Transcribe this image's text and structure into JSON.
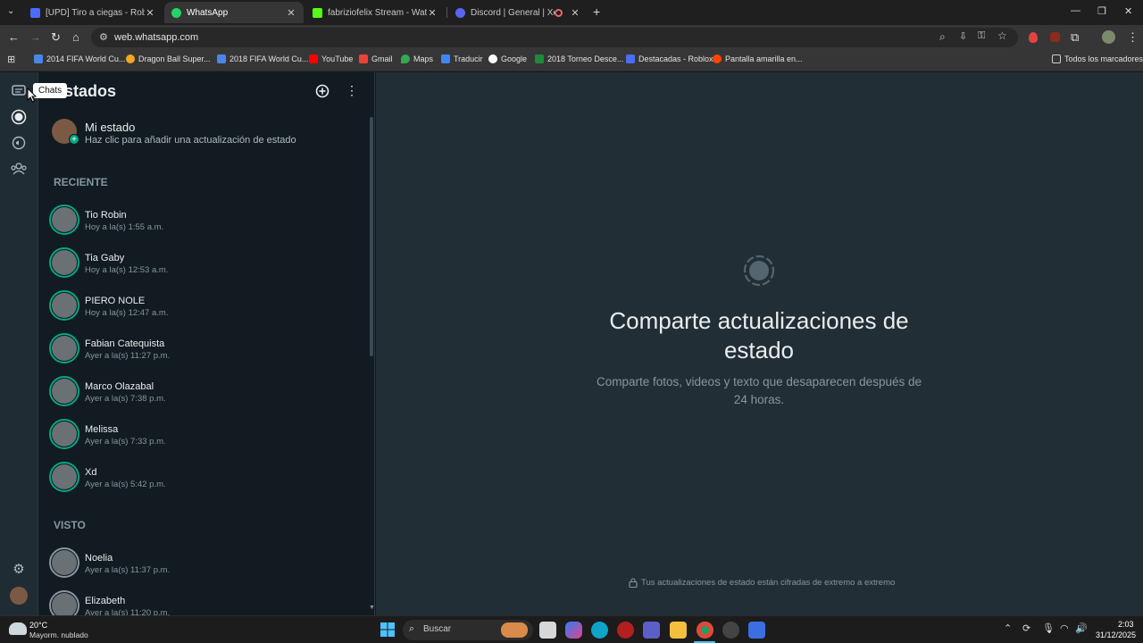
{
  "browser": {
    "tabs": [
      {
        "title": "[UPD] Tiro a ciegas - Roblox",
        "color": "#4a6cf7"
      },
      {
        "title": "WhatsApp",
        "color": "#25d366"
      },
      {
        "title": "fabriziofelix Stream - Watch Liv",
        "color": "#53fc18"
      },
      {
        "title": "Discord | General | Xddd",
        "color": "#5865f2"
      }
    ],
    "url": "web.whatsapp.com",
    "bookmarks": [
      "2014 FIFA World Cu...",
      "Dragon Ball Super...",
      "2018 FIFA World Cu...",
      "YouTube",
      "Gmail",
      "Maps",
      "Traducir",
      "Google",
      "2018 Torneo Desce...",
      "Destacadas - Roblox",
      "Pantalla amarilla en...",
      "Todos los marcadores"
    ]
  },
  "whatsapp": {
    "tooltip": "Chats",
    "panel_title": "Estados",
    "my_status": {
      "title": "Mi estado",
      "subtitle": "Haz clic para añadir una actualización de estado"
    },
    "recent_header": "RECIENTE",
    "recent": [
      {
        "name": "Tio Robin",
        "time": "Hoy a la(s) 1:55 a.m."
      },
      {
        "name": "Tia Gaby",
        "time": "Hoy a la(s) 12:53 a.m."
      },
      {
        "name": "PIERO NOLE",
        "time": "Hoy a la(s) 12:47 a.m."
      },
      {
        "name": "Fabian Catequista",
        "time": "Ayer a la(s) 11:27 p.m."
      },
      {
        "name": "Marco Olazabal",
        "time": "Ayer a la(s) 7:38 p.m."
      },
      {
        "name": "Melissa",
        "time": "Ayer a la(s) 7:33 p.m."
      },
      {
        "name": "Xd",
        "time": "Ayer a la(s) 5:42 p.m."
      }
    ],
    "seen_header": "VISTO",
    "seen": [
      {
        "name": "Noelia",
        "time": "Ayer a la(s) 11:37 p.m."
      },
      {
        "name": "Elizabeth",
        "time": "Ayer a la(s) 11:20 p.m."
      }
    ],
    "main_title": "Comparte actualizaciones de estado",
    "main_subtitle": "Comparte fotos, videos y texto que desaparecen después de 24 horas.",
    "encryption_note": "Tus actualizaciones de estado están cifradas de extremo a extremo",
    "accent_color": "#00a884"
  },
  "taskbar": {
    "weather_temp": "20°C",
    "weather_desc": "Mayorm. nublado",
    "search_placeholder": "Buscar",
    "time": "2:03",
    "date": "31/12/2025"
  }
}
